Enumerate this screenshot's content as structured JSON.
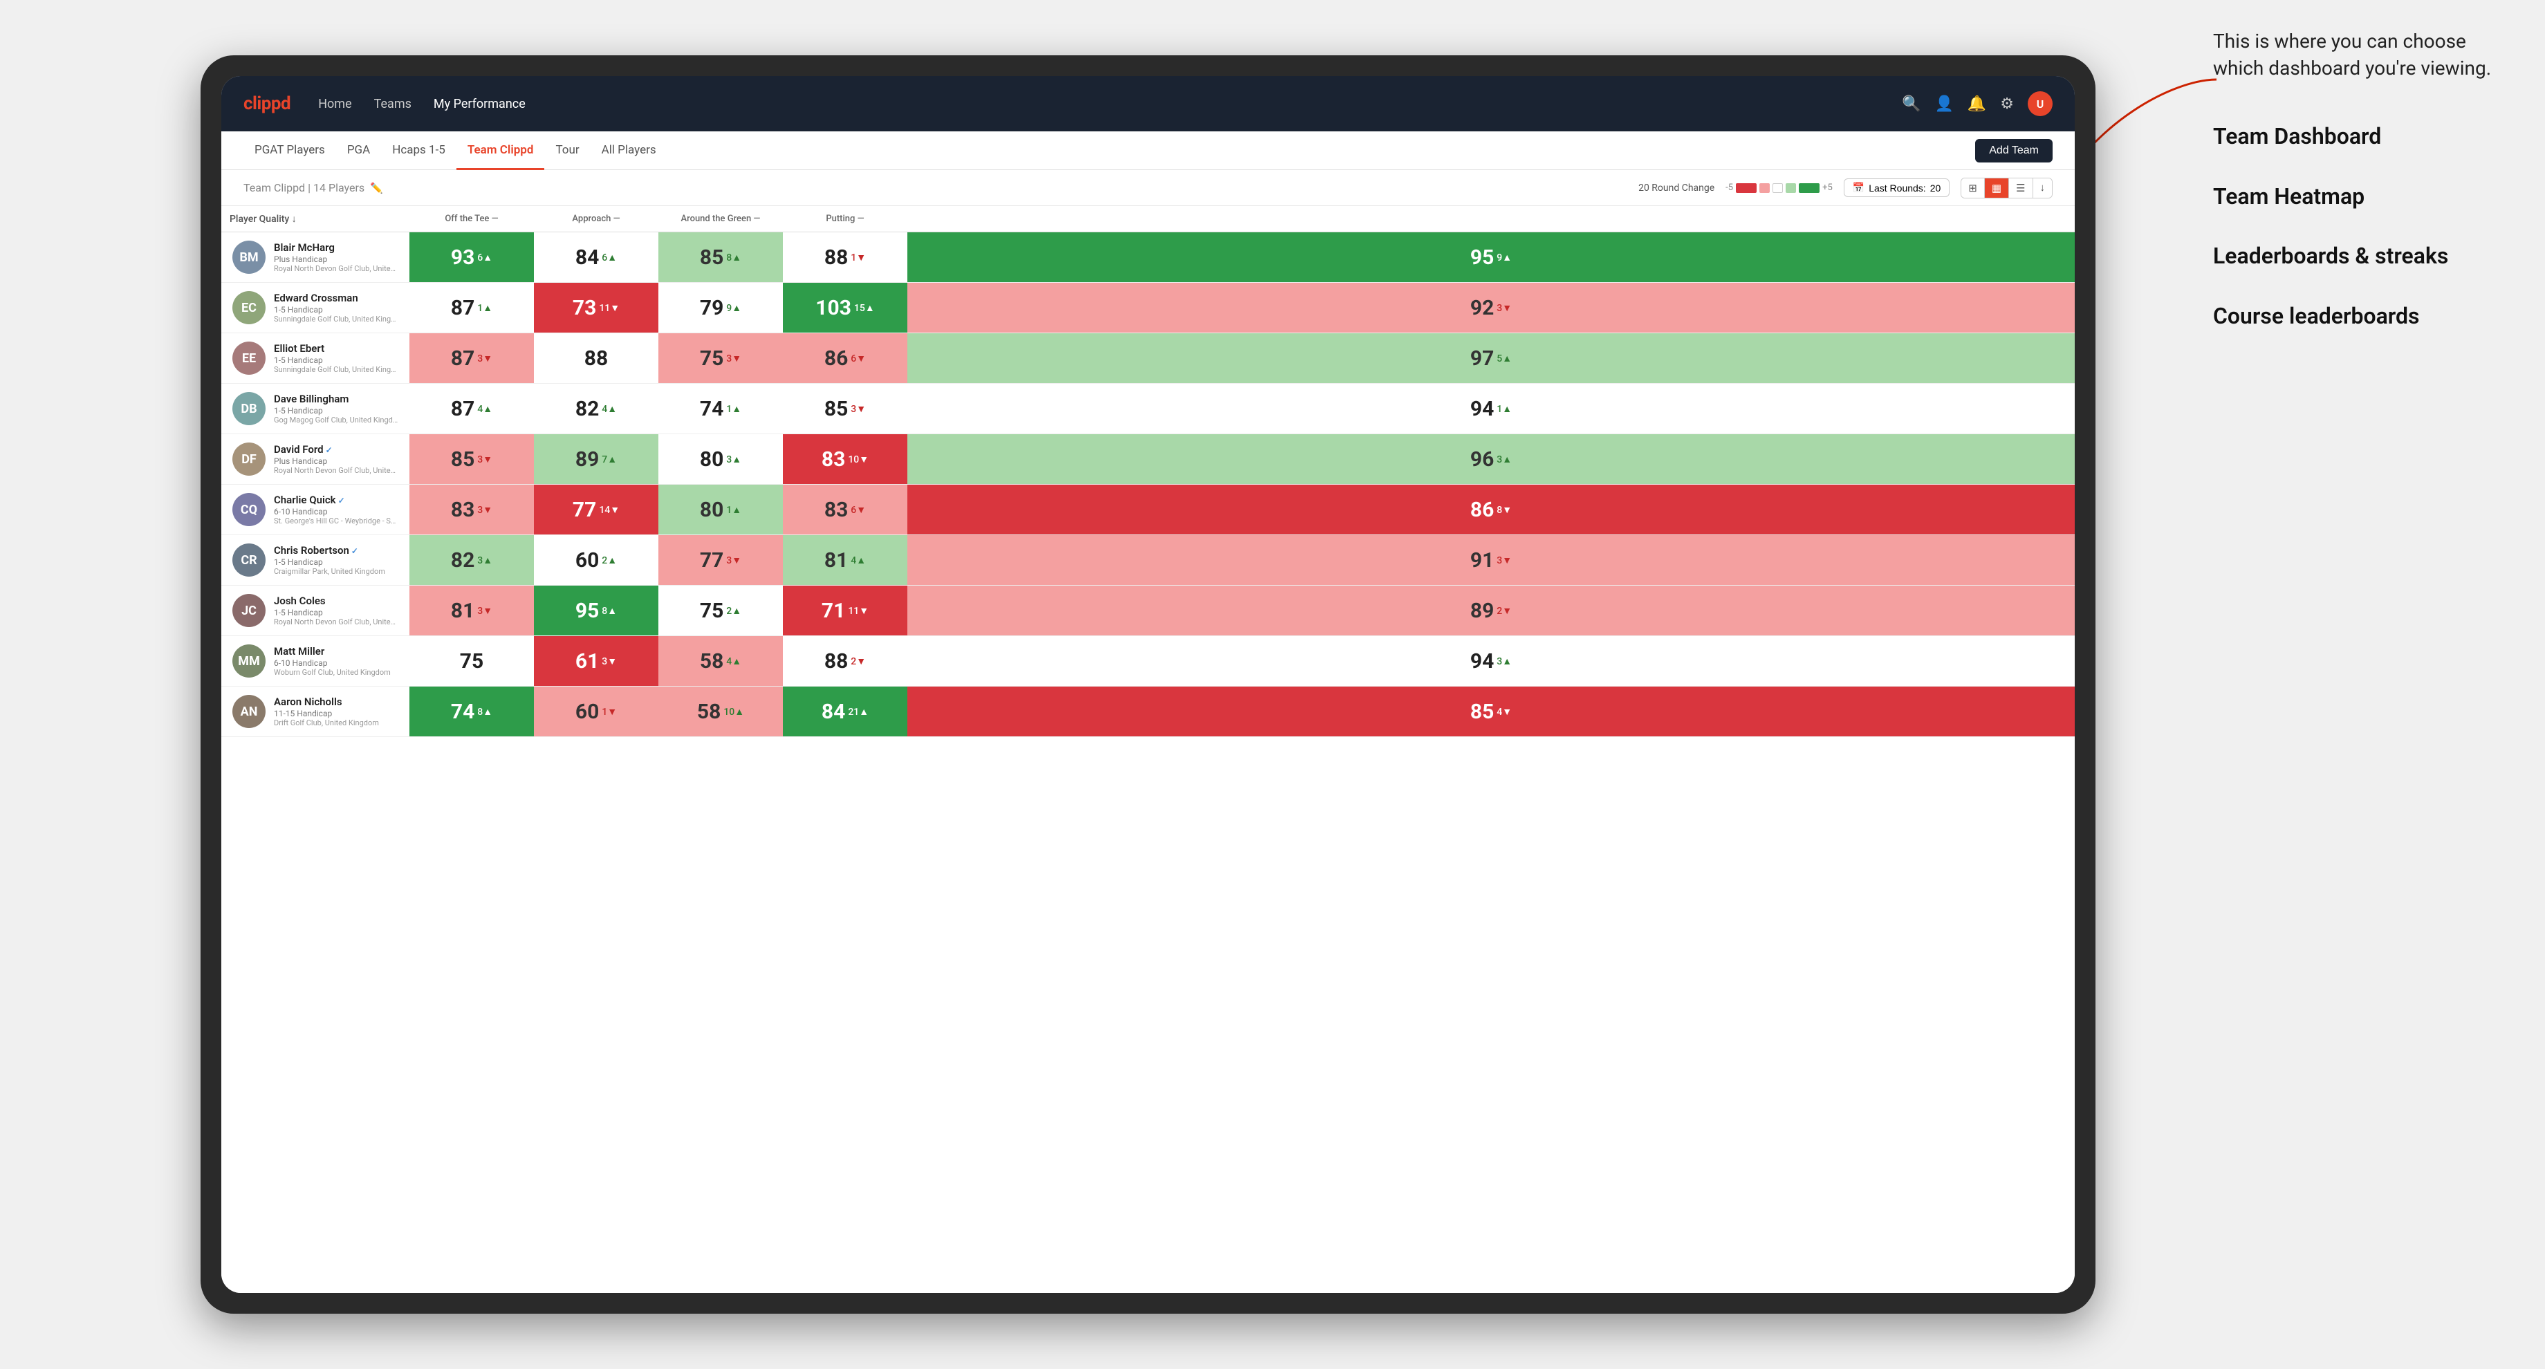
{
  "annotation": {
    "intro": "This is where you can choose which dashboard you're viewing.",
    "items": [
      "Team Dashboard",
      "Team Heatmap",
      "Leaderboards & streaks",
      "Course leaderboards"
    ]
  },
  "navbar": {
    "logo": "clippd",
    "links": [
      {
        "label": "Home",
        "active": false
      },
      {
        "label": "Teams",
        "active": false
      },
      {
        "label": "My Performance",
        "active": true
      }
    ],
    "icons": [
      "search",
      "person",
      "bell",
      "settings",
      "avatar"
    ]
  },
  "subtabs": {
    "tabs": [
      {
        "label": "PGAT Players",
        "active": false
      },
      {
        "label": "PGA",
        "active": false
      },
      {
        "label": "Hcaps 1-5",
        "active": false
      },
      {
        "label": "Team Clippd",
        "active": true
      },
      {
        "label": "Tour",
        "active": false
      },
      {
        "label": "All Players",
        "active": false
      }
    ],
    "add_team_label": "Add Team"
  },
  "team_header": {
    "team_name": "Team Clippd",
    "player_count": "14 Players",
    "round_change_label": "20 Round Change",
    "change_minus": "-5",
    "change_plus": "+5",
    "last_rounds_label": "Last Rounds:",
    "last_rounds_value": "20"
  },
  "table": {
    "columns": [
      {
        "key": "player",
        "label": "Player Quality ↓"
      },
      {
        "key": "offTee",
        "label": "Off the Tee —"
      },
      {
        "key": "approach",
        "label": "Approach —"
      },
      {
        "key": "aroundGreen",
        "label": "Around the Green —"
      },
      {
        "key": "putting",
        "label": "Putting —"
      }
    ],
    "rows": [
      {
        "name": "Blair McHarg",
        "handicap": "Plus Handicap",
        "club": "Royal North Devon Golf Club, United Kingdom",
        "avatar_color": "#7a8fa6",
        "avatar_initials": "BM",
        "scores": [
          {
            "value": "93",
            "change": "6",
            "direction": "up",
            "bg": "green-dark"
          },
          {
            "value": "84",
            "change": "6",
            "direction": "up",
            "bg": "white"
          },
          {
            "value": "85",
            "change": "8",
            "direction": "up",
            "bg": "green-light"
          },
          {
            "value": "88",
            "change": "1",
            "direction": "down",
            "bg": "white"
          },
          {
            "value": "95",
            "change": "9",
            "direction": "up",
            "bg": "green-dark"
          }
        ]
      },
      {
        "name": "Edward Crossman",
        "handicap": "1-5 Handicap",
        "club": "Sunningdale Golf Club, United Kingdom",
        "avatar_color": "#8fa67a",
        "avatar_initials": "EC",
        "scores": [
          {
            "value": "87",
            "change": "1",
            "direction": "up",
            "bg": "white"
          },
          {
            "value": "73",
            "change": "11",
            "direction": "down",
            "bg": "red-dark"
          },
          {
            "value": "79",
            "change": "9",
            "direction": "up",
            "bg": "white"
          },
          {
            "value": "103",
            "change": "15",
            "direction": "up",
            "bg": "green-dark"
          },
          {
            "value": "92",
            "change": "3",
            "direction": "down",
            "bg": "red-light"
          }
        ]
      },
      {
        "name": "Elliot Ebert",
        "handicap": "1-5 Handicap",
        "club": "Sunningdale Golf Club, United Kingdom",
        "avatar_color": "#a67a7a",
        "avatar_initials": "EE",
        "scores": [
          {
            "value": "87",
            "change": "3",
            "direction": "down",
            "bg": "red-light"
          },
          {
            "value": "88",
            "change": "",
            "direction": "",
            "bg": "white"
          },
          {
            "value": "75",
            "change": "3",
            "direction": "down",
            "bg": "red-light"
          },
          {
            "value": "86",
            "change": "6",
            "direction": "down",
            "bg": "red-light"
          },
          {
            "value": "97",
            "change": "5",
            "direction": "up",
            "bg": "green-light"
          }
        ]
      },
      {
        "name": "Dave Billingham",
        "handicap": "1-5 Handicap",
        "club": "Gog Magog Golf Club, United Kingdom",
        "avatar_color": "#7aa6a6",
        "avatar_initials": "DB",
        "scores": [
          {
            "value": "87",
            "change": "4",
            "direction": "up",
            "bg": "white"
          },
          {
            "value": "82",
            "change": "4",
            "direction": "up",
            "bg": "white"
          },
          {
            "value": "74",
            "change": "1",
            "direction": "up",
            "bg": "white"
          },
          {
            "value": "85",
            "change": "3",
            "direction": "down",
            "bg": "white"
          },
          {
            "value": "94",
            "change": "1",
            "direction": "up",
            "bg": "white"
          }
        ]
      },
      {
        "name": "David Ford",
        "handicap": "Plus Handicap",
        "club": "Royal North Devon Golf Club, United Kingdom",
        "avatar_color": "#a6937a",
        "avatar_initials": "DF",
        "verified": true,
        "scores": [
          {
            "value": "85",
            "change": "3",
            "direction": "down",
            "bg": "red-light"
          },
          {
            "value": "89",
            "change": "7",
            "direction": "up",
            "bg": "green-light"
          },
          {
            "value": "80",
            "change": "3",
            "direction": "up",
            "bg": "white"
          },
          {
            "value": "83",
            "change": "10",
            "direction": "down",
            "bg": "red-dark"
          },
          {
            "value": "96",
            "change": "3",
            "direction": "up",
            "bg": "green-light"
          }
        ]
      },
      {
        "name": "Charlie Quick",
        "handicap": "6-10 Handicap",
        "club": "St. George's Hill GC - Weybridge - Surrey, Uni...",
        "avatar_color": "#7a7aa6",
        "avatar_initials": "CQ",
        "verified": true,
        "scores": [
          {
            "value": "83",
            "change": "3",
            "direction": "down",
            "bg": "red-light"
          },
          {
            "value": "77",
            "change": "14",
            "direction": "down",
            "bg": "red-dark"
          },
          {
            "value": "80",
            "change": "1",
            "direction": "up",
            "bg": "green-light"
          },
          {
            "value": "83",
            "change": "6",
            "direction": "down",
            "bg": "red-light"
          },
          {
            "value": "86",
            "change": "8",
            "direction": "down",
            "bg": "red-dark"
          }
        ]
      },
      {
        "name": "Chris Robertson",
        "handicap": "1-5 Handicap",
        "club": "Craigmillar Park, United Kingdom",
        "avatar_color": "#6a7a8a",
        "avatar_initials": "CR",
        "verified": true,
        "scores": [
          {
            "value": "82",
            "change": "3",
            "direction": "up",
            "bg": "green-light"
          },
          {
            "value": "60",
            "change": "2",
            "direction": "up",
            "bg": "white"
          },
          {
            "value": "77",
            "change": "3",
            "direction": "down",
            "bg": "red-light"
          },
          {
            "value": "81",
            "change": "4",
            "direction": "up",
            "bg": "green-light"
          },
          {
            "value": "91",
            "change": "3",
            "direction": "down",
            "bg": "red-light"
          }
        ]
      },
      {
        "name": "Josh Coles",
        "handicap": "1-5 Handicap",
        "club": "Royal North Devon Golf Club, United Kingdom",
        "avatar_color": "#8a6a6a",
        "avatar_initials": "JC",
        "scores": [
          {
            "value": "81",
            "change": "3",
            "direction": "down",
            "bg": "red-light"
          },
          {
            "value": "95",
            "change": "8",
            "direction": "up",
            "bg": "green-dark"
          },
          {
            "value": "75",
            "change": "2",
            "direction": "up",
            "bg": "white"
          },
          {
            "value": "71",
            "change": "11",
            "direction": "down",
            "bg": "red-dark"
          },
          {
            "value": "89",
            "change": "2",
            "direction": "down",
            "bg": "red-light"
          }
        ]
      },
      {
        "name": "Matt Miller",
        "handicap": "6-10 Handicap",
        "club": "Woburn Golf Club, United Kingdom",
        "avatar_color": "#7a8a6a",
        "avatar_initials": "MM",
        "scores": [
          {
            "value": "75",
            "change": "",
            "direction": "",
            "bg": "white"
          },
          {
            "value": "61",
            "change": "3",
            "direction": "down",
            "bg": "red-dark"
          },
          {
            "value": "58",
            "change": "4",
            "direction": "up",
            "bg": "red-light"
          },
          {
            "value": "88",
            "change": "2",
            "direction": "down",
            "bg": "white"
          },
          {
            "value": "94",
            "change": "3",
            "direction": "up",
            "bg": "white"
          }
        ]
      },
      {
        "name": "Aaron Nicholls",
        "handicap": "11-15 Handicap",
        "club": "Drift Golf Club, United Kingdom",
        "avatar_color": "#8a7a6a",
        "avatar_initials": "AN",
        "scores": [
          {
            "value": "74",
            "change": "8",
            "direction": "up",
            "bg": "green-dark"
          },
          {
            "value": "60",
            "change": "1",
            "direction": "down",
            "bg": "red-light"
          },
          {
            "value": "58",
            "change": "10",
            "direction": "up",
            "bg": "red-light"
          },
          {
            "value": "84",
            "change": "21",
            "direction": "up",
            "bg": "green-dark"
          },
          {
            "value": "85",
            "change": "4",
            "direction": "down",
            "bg": "red-dark"
          }
        ]
      }
    ]
  }
}
